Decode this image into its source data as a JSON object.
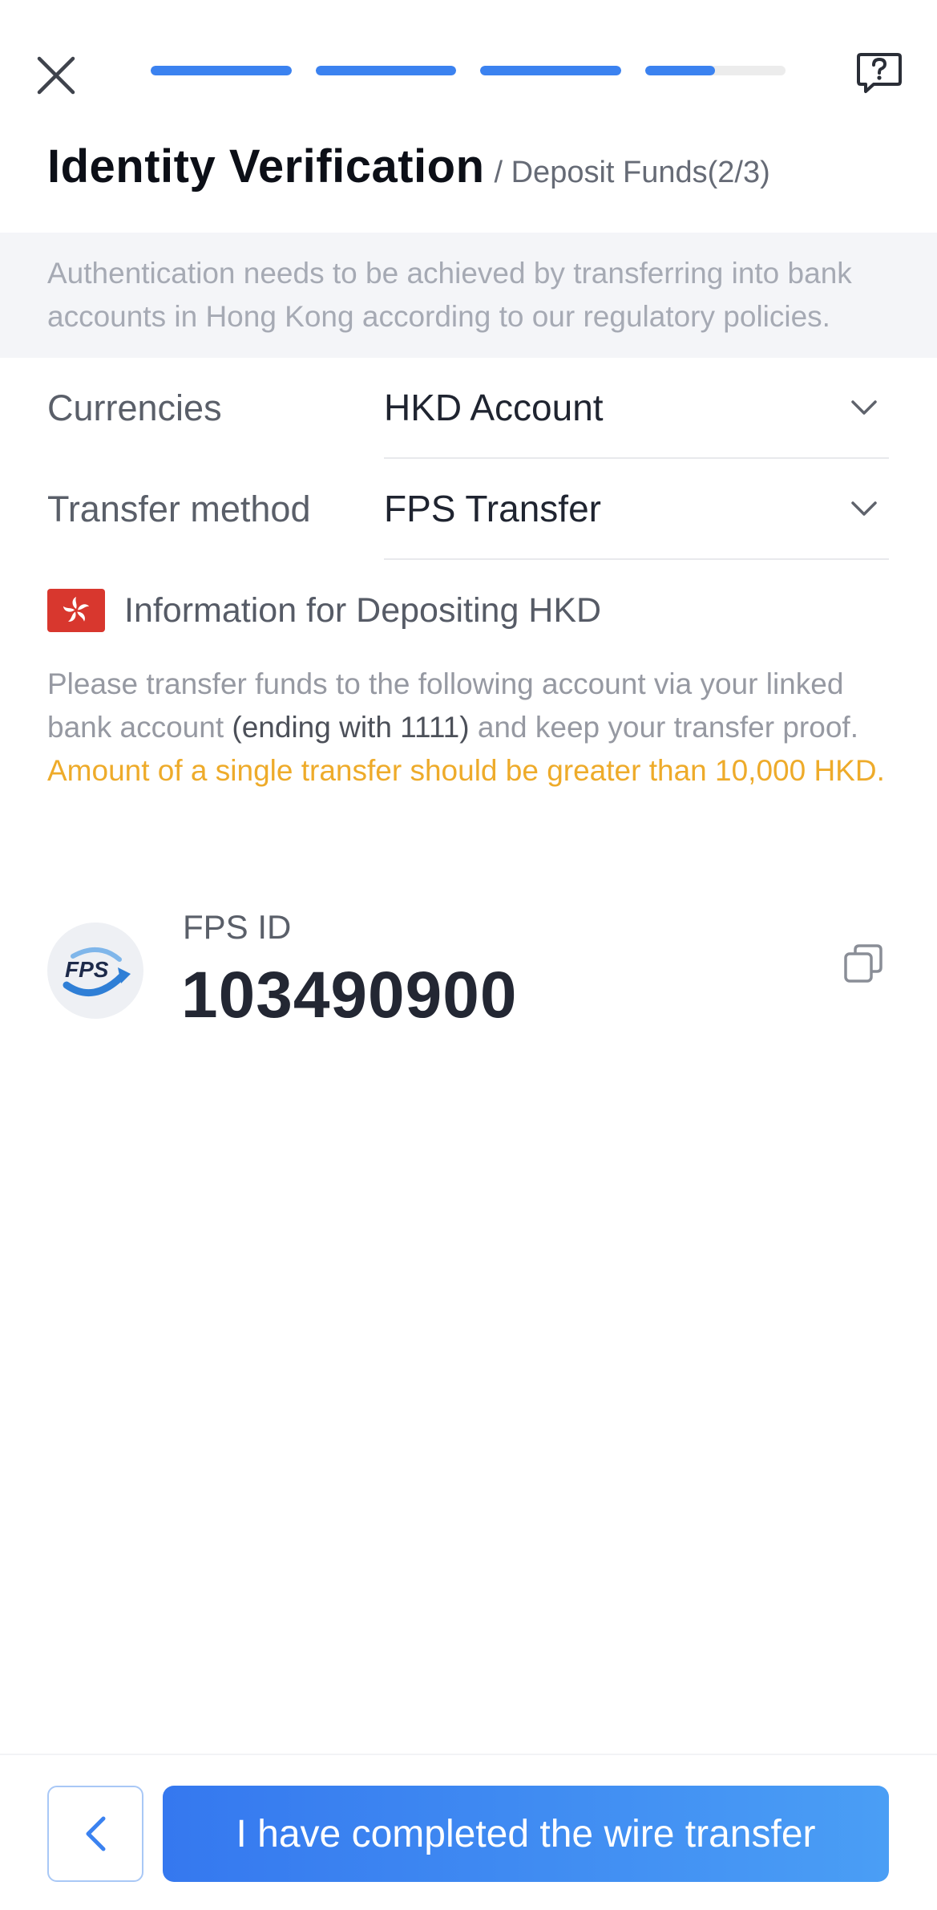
{
  "header": {
    "close_icon": "close-icon",
    "help_icon": "help-icon",
    "progress": [
      1,
      1,
      1,
      0.5
    ],
    "title": "Identity Verification",
    "subtitle": "/ Deposit Funds(2/3)"
  },
  "notice": {
    "text": "Authentication needs to be achieved by transferring into bank accounts in Hong Kong according to our regulatory policies."
  },
  "form": {
    "currencies": {
      "label": "Currencies",
      "value": "HKD Account"
    },
    "transfer_method": {
      "label": "Transfer method",
      "value": "FPS Transfer"
    }
  },
  "info": {
    "flag_icon": "hong-kong-flag-icon",
    "title": "Information for Depositing HKD",
    "desc_part1": "Please transfer funds to the following account via your linked bank account ",
    "desc_highlight": "(ending with 1111)",
    "desc_part2": " and keep your transfer proof.",
    "warning": "Amount of a single transfer should be greater than 10,000 HKD."
  },
  "fps": {
    "logo_text": "FPS",
    "label": "FPS ID",
    "value": "103490900"
  },
  "footer": {
    "back_icon": "chevron-left-icon",
    "confirm_label": "I have completed the wire transfer"
  },
  "colors": {
    "accent": "#3b82f0",
    "warning": "#eeab2a",
    "flag_red": "#d8372e"
  }
}
